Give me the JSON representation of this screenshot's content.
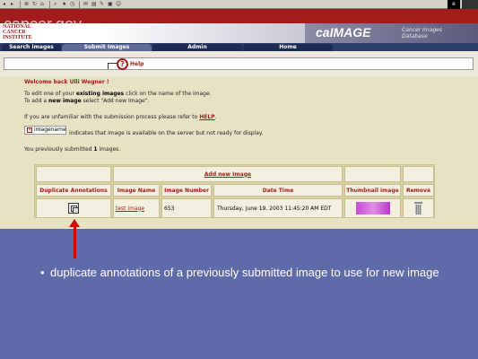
{
  "browser": {
    "toolbar_icons": [
      "back-icon",
      "forward-icon",
      "stop-icon",
      "refresh-icon",
      "home-icon",
      "search-icon",
      "favorites-icon",
      "history-icon",
      "mail-icon",
      "print-icon",
      "edit-icon",
      "discuss-icon",
      "messenger-icon"
    ]
  },
  "header": {
    "site_logo": "cancer.gov",
    "nci_logo": "NATIONAL CANCER INSTITUTE",
    "app_title": "caIMAGE",
    "app_subtitle": "Cancer Images Database"
  },
  "nav": {
    "tabs": [
      {
        "label": "Search Images"
      },
      {
        "label": "Submit Images"
      },
      {
        "label": "Admin"
      },
      {
        "label": "Home"
      }
    ],
    "active_tab": "Submit Images"
  },
  "help": {
    "label": "Help"
  },
  "main": {
    "welcome": "Welcome back Ulli Wegner !",
    "line1_pre": "To edit one of your ",
    "line1_bold": "existing images",
    "line1_post": " click on the name of the image.",
    "line2_pre": "To add a ",
    "line2_bold": "new image",
    "line2_post": " select \"Add new Image\".",
    "line3_pre": "If you are unfamiliar with the submission process please refer to ",
    "line3_link": "HELP",
    "line3_post": ".",
    "legend_name": "imagename",
    "legend_text": "indicates that image is available on the server but not ready for display.",
    "submitted": "You previously submitted ",
    "submitted_count": "1",
    "submitted_post": " images."
  },
  "table": {
    "add_link": "Add new Image",
    "headers": [
      "Duplicate Annotations",
      "Image Name",
      "Image Number",
      "Date Time",
      "Thumbnail image",
      "Remove"
    ],
    "rows": [
      {
        "image_name": "test image",
        "image_number": "653",
        "date_time": "Thursday, June 19, 2003 11:45:20 AM EDT"
      }
    ]
  },
  "annotation": {
    "bullet": "•",
    "text": "duplicate annotations of a previously submitted image to use for new image",
    "arrow_color": "#e00000"
  },
  "colors": {
    "brand_red": "#a31c1c",
    "nav_navy": "#2b3d6a",
    "content_bg": "#e8e2c4",
    "slide_bg": "#5f6aa8"
  }
}
